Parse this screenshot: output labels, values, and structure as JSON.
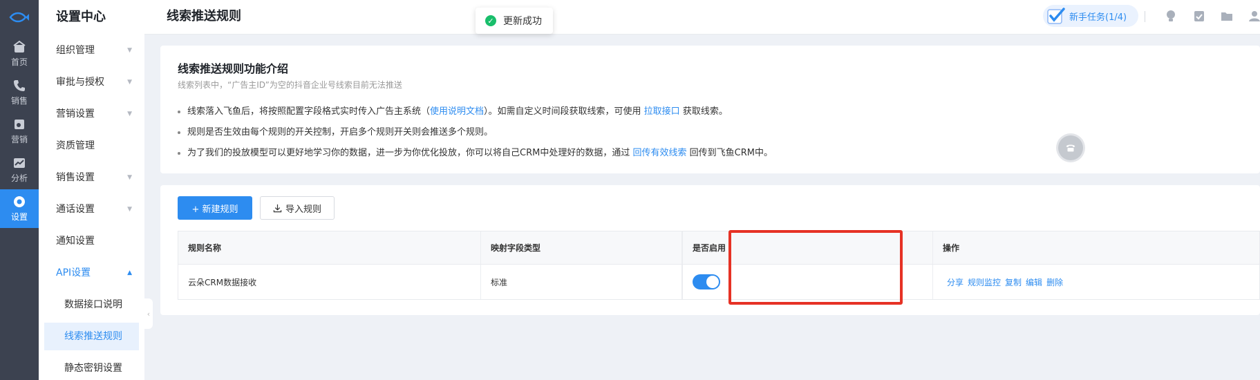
{
  "rail": {
    "items": [
      {
        "label": "首页",
        "icon": "home-icon"
      },
      {
        "label": "销售",
        "icon": "phone-icon"
      },
      {
        "label": "营销",
        "icon": "marketing-icon"
      },
      {
        "label": "分析",
        "icon": "chart-icon"
      },
      {
        "label": "设置",
        "icon": "settings-icon"
      }
    ]
  },
  "menu": {
    "title": "设置中心",
    "items": [
      {
        "label": "组织管理"
      },
      {
        "label": "审批与授权"
      },
      {
        "label": "营销设置"
      },
      {
        "label": "资质管理"
      },
      {
        "label": "销售设置"
      },
      {
        "label": "通话设置"
      },
      {
        "label": "通知设置"
      },
      {
        "label": "API设置"
      }
    ],
    "sub_items": [
      {
        "label": "数据接口说明"
      },
      {
        "label": "线索推送规则"
      },
      {
        "label": "静态密钥设置"
      }
    ]
  },
  "header": {
    "title": "线索推送规则",
    "toast": "更新成功",
    "task_label": "新手任务(1/4)"
  },
  "intro": {
    "title": "线索推送规则功能介绍",
    "subtitle": "线索列表中，“广告主ID”为空的抖音企业号线索目前无法推送",
    "b1_pre": "线索落入飞鱼后，将按照配置字段格式实时传入广告主系统（",
    "b1_link1": "使用说明文档",
    "b1_mid": "）。如需自定义时间段获取线索，可使用 ",
    "b1_link2": "拉取接口",
    "b1_post": " 获取线索。",
    "b2": "规则是否生效由每个规则的开关控制，开启多个规则开关则会推送多个规则。",
    "b3_pre": "为了我们的投放模型可以更好地学习你的数据，进一步为你优化投放，你可以将自己CRM中处理好的数据，通过 ",
    "b3_link": "回传有效线索",
    "b3_post": " 回传到飞鱼CRM中。"
  },
  "rules": {
    "new_button": "+ 新建规则",
    "import_button": "导入规则",
    "columns": [
      "规则名称",
      "映射字段类型",
      "是否启用",
      "操作"
    ],
    "rows": [
      {
        "name": "云朵CRM数据接收",
        "type": "标准",
        "enabled": true
      }
    ],
    "actions": [
      "分享",
      "规则监控",
      "复制",
      "编辑",
      "删除"
    ]
  },
  "colors": {
    "accent": "#2d8cf0",
    "highlight": "#e63225",
    "success": "#19be6b"
  }
}
